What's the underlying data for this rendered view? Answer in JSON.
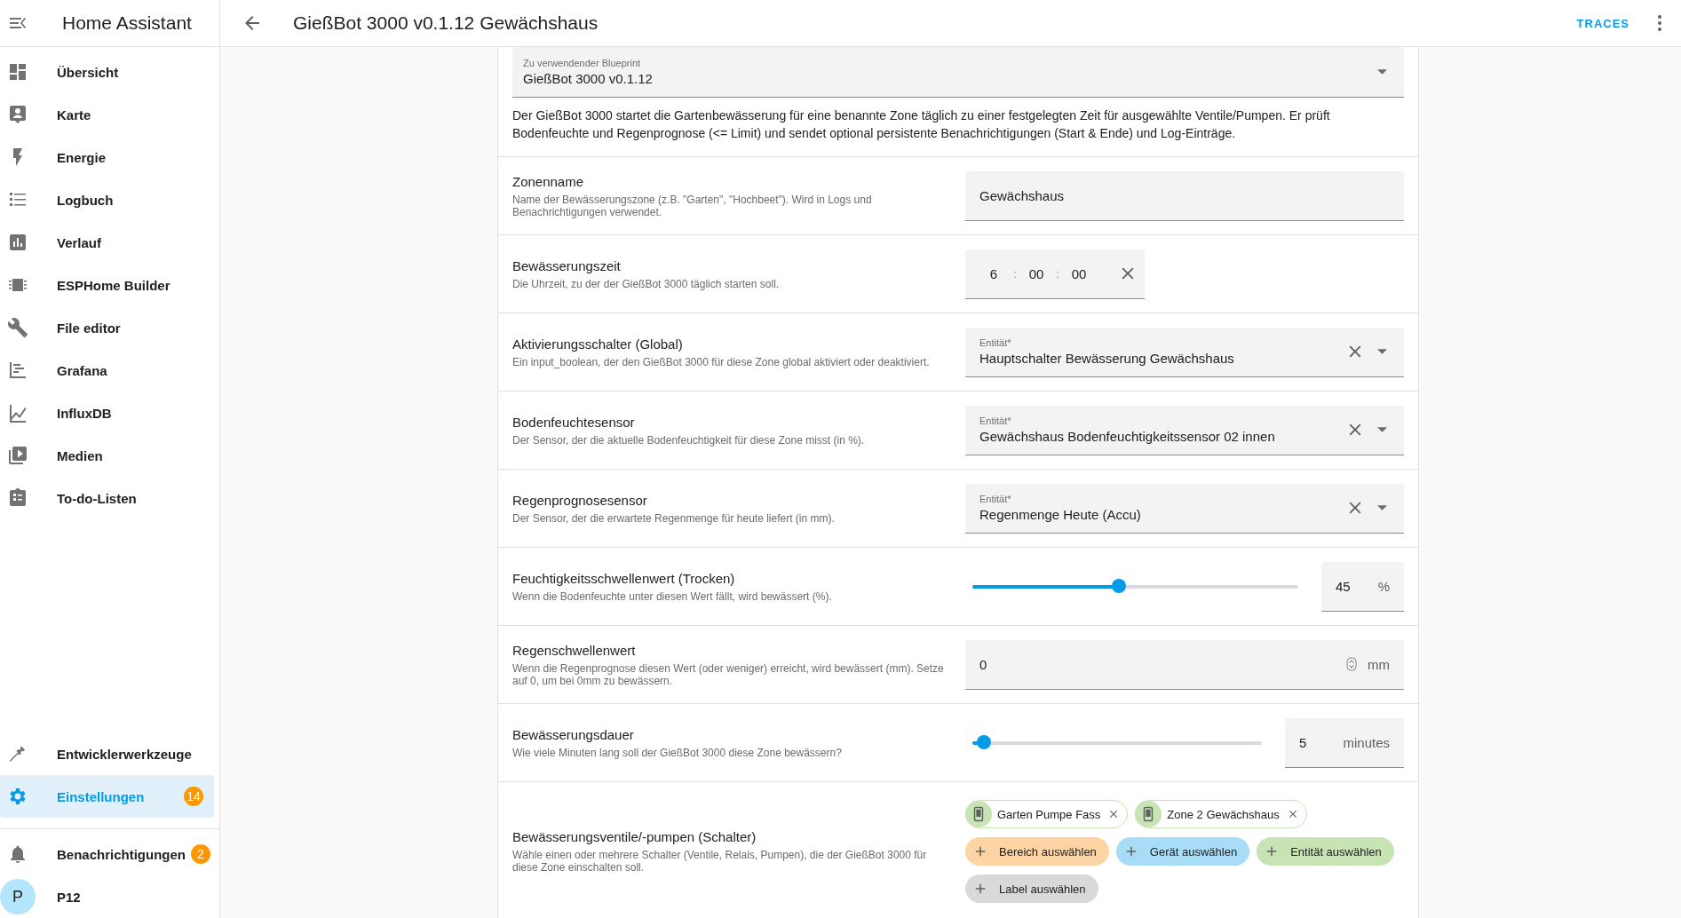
{
  "sidebar": {
    "title": "Home Assistant",
    "items": [
      {
        "label": "Übersicht",
        "selected": false
      },
      {
        "label": "Karte",
        "selected": false
      },
      {
        "label": "Energie",
        "selected": false
      },
      {
        "label": "Logbuch",
        "selected": false
      },
      {
        "label": "Verlauf",
        "selected": false
      },
      {
        "label": "ESPHome Builder",
        "selected": false
      },
      {
        "label": "File editor",
        "selected": false
      },
      {
        "label": "Grafana",
        "selected": false
      },
      {
        "label": "InfluxDB",
        "selected": false
      },
      {
        "label": "Medien",
        "selected": false
      },
      {
        "label": "To-do-Listen",
        "selected": false
      }
    ],
    "footer_items": [
      {
        "label": "Entwicklerwerkzeuge",
        "selected": false
      },
      {
        "label": "Einstellungen",
        "selected": true,
        "badge": "14"
      }
    ],
    "notifications": {
      "label": "Benachrichtigungen",
      "badge": "2"
    },
    "user": {
      "initial": "P",
      "name": "P12"
    }
  },
  "header": {
    "title": "GießBot 3000 v0.1.12 Gewächshaus",
    "action": "TRACES"
  },
  "blueprint": {
    "label": "Zu verwendender Blueprint",
    "value": "GießBot 3000 v0.1.12",
    "description": "Der GießBot 3000 startet die Gartenbewässerung für eine benannte Zone täglich zu einer festgelegten Zeit für ausgewählte Ventile/Pumpen. Er prüft Bodenfeuchte und Regenprognose (<= Limit) und sendet optional persistente Benachrichtigungen (Start & Ende) und Log-Einträge."
  },
  "inputs": [
    {
      "kind": "text",
      "title": "Zonenname",
      "description": "Name der Bewässerungszone (z.B. \"Garten\", \"Hochbeet\"). Wird in Logs und Benachrichtigungen verwendet.",
      "value": "Gewächshaus"
    },
    {
      "kind": "time",
      "title": "Bewässerungszeit",
      "description": "Die Uhrzeit, zu der der GießBot 3000 täglich starten soll.",
      "hours": "6",
      "minutes": "00",
      "seconds": "00",
      "separators": [
        ":",
        ":"
      ]
    },
    {
      "kind": "entity",
      "title": "Aktivierungsschalter (Global)",
      "description": "Ein input_boolean, der den GießBot 3000 für diese Zone global aktiviert oder deaktiviert.",
      "label": "Entität*",
      "value": "Hauptschalter Bewässerung Gewächshaus"
    },
    {
      "kind": "entity",
      "title": "Bodenfeuchtesensor",
      "description": "Der Sensor, der die aktuelle Bodenfeuchtigkeit für diese Zone misst (in %).",
      "label": "Entität*",
      "value": "Gewächshaus Bodenfeuchtigkeitssensor 02 innen"
    },
    {
      "kind": "entity",
      "title": "Regenprognosesensor",
      "description": "Der Sensor, der die erwartete Regenmenge für heute liefert (in mm).",
      "label": "Entität*",
      "value": "Regenmenge Heute (Accu)"
    },
    {
      "kind": "slider",
      "title": "Feuchtigkeitsschwellenwert (Trocken)",
      "description": "Wenn die Bodenfeuchte unter diesen Wert fällt, wird bewässert (%).",
      "level": 0.45,
      "value": "45",
      "unit": "%"
    },
    {
      "kind": "number",
      "title": "Regenschwellenwert",
      "description": "Wenn die Regenprognose diesen Wert (oder weniger) erreicht, wird bewässert (mm). Setze auf 0, um bei 0mm zu bewässern.",
      "value": "0",
      "unit": "mm"
    },
    {
      "kind": "slider",
      "title": "Bewässerungsdauer",
      "description": "Wie viele Minuten lang soll der GießBot 3000 diese Zone bewässern?",
      "level": 0.04,
      "value": "5",
      "unit": "minutes"
    },
    {
      "kind": "target",
      "title": "Bewässerungsventile/-pumpen (Schalter)",
      "description": "Wähle einen oder mehrere Schalter (Ventile, Relais, Pumpen), die der GießBot 3000 für diese Zone einschalten soll.",
      "chips": [
        {
          "label": "Garten Pumpe Fass"
        },
        {
          "label": "Zone 2 Gewächshaus"
        }
      ],
      "buttons": [
        {
          "label": "Bereich auswählen",
          "color": "#fdd5a4"
        },
        {
          "label": "Gerät auswählen",
          "color": "#a9dcf6"
        },
        {
          "label": "Entität auswählen",
          "color": "#c8e4b4"
        },
        {
          "label": "Label auswählen",
          "color": "#d9d9d9"
        }
      ]
    }
  ]
}
